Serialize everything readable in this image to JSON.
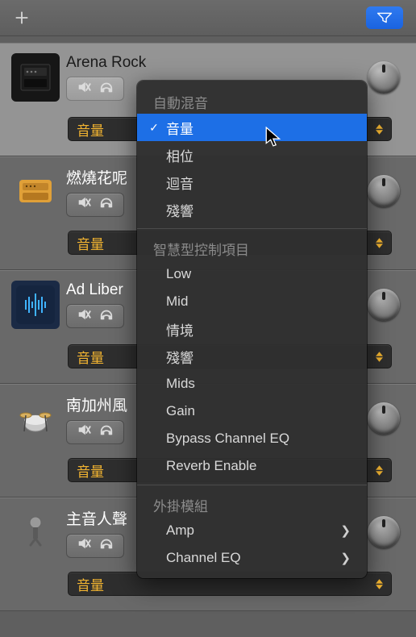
{
  "toolbar": {
    "add_icon": "plus-icon",
    "filter_icon": "funnel-icon"
  },
  "tracks": [
    {
      "name": "Arena Rock",
      "icon": "amp",
      "selected": true,
      "automation_param": "音量"
    },
    {
      "name": "燃燒花呢",
      "icon": "amber",
      "selected": false,
      "automation_param": "音量"
    },
    {
      "name": "Ad Liber",
      "icon": "wave",
      "selected": false,
      "automation_param": "音量"
    },
    {
      "name": "南加州風",
      "icon": "kit",
      "selected": false,
      "automation_param": "音量"
    },
    {
      "name": "主音人聲",
      "icon": "mic",
      "selected": false,
      "automation_param": "音量"
    }
  ],
  "menu": {
    "sections": [
      {
        "title": "自動混音",
        "items": [
          {
            "label": "音量",
            "selected": true
          },
          {
            "label": "相位"
          },
          {
            "label": "迴音"
          },
          {
            "label": "殘響"
          }
        ]
      },
      {
        "title": "智慧型控制項目",
        "items": [
          {
            "label": "Low"
          },
          {
            "label": "Mid"
          },
          {
            "label": "情境"
          },
          {
            "label": "殘響"
          },
          {
            "label": "Mids"
          },
          {
            "label": "Gain"
          },
          {
            "label": "Bypass Channel EQ"
          },
          {
            "label": "Reverb Enable"
          }
        ]
      },
      {
        "title": "外掛模組",
        "items": [
          {
            "label": "Amp",
            "submenu": true
          },
          {
            "label": "Channel EQ",
            "submenu": true
          }
        ]
      }
    ]
  },
  "colors": {
    "accent": "#1d6fe6",
    "param": "#f2b431"
  }
}
